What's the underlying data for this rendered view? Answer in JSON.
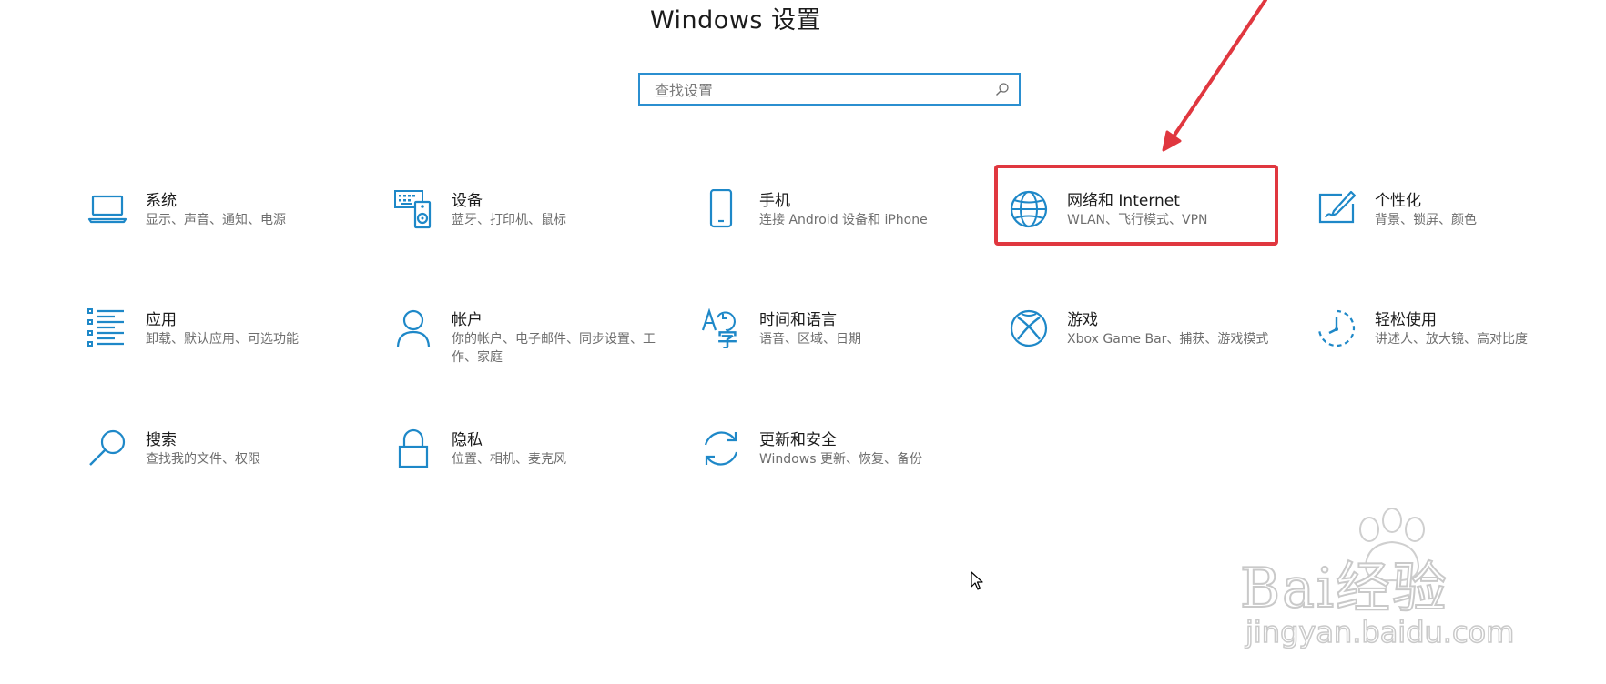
{
  "window": {
    "title": "Windows 设置"
  },
  "search": {
    "placeholder": "查找设置",
    "value": ""
  },
  "tiles": [
    {
      "title": "系统",
      "desc": "显示、声音、通知、电源",
      "icon": "laptop-icon"
    },
    {
      "title": "设备",
      "desc": "蓝牙、打印机、鼠标",
      "icon": "keyboard-speaker-icon"
    },
    {
      "title": "手机",
      "desc": "连接 Android 设备和 iPhone",
      "icon": "phone-icon"
    },
    {
      "title": "网络和 Internet",
      "desc": "WLAN、飞行模式、VPN",
      "icon": "globe-icon"
    },
    {
      "title": "个性化",
      "desc": "背景、锁屏、颜色",
      "icon": "pen-tablet-icon"
    },
    {
      "title": "应用",
      "desc": "卸载、默认应用、可选功能",
      "icon": "apps-list-icon"
    },
    {
      "title": "帐户",
      "desc": "你的帐户、电子邮件、同步设置、工作、家庭",
      "icon": "person-icon"
    },
    {
      "title": "时间和语言",
      "desc": "语音、区域、日期",
      "icon": "time-language-icon"
    },
    {
      "title": "游戏",
      "desc": "Xbox Game Bar、捕获、游戏模式",
      "icon": "xbox-icon"
    },
    {
      "title": "轻松使用",
      "desc": "讲述人、放大镜、高对比度",
      "icon": "ease-of-access-icon"
    },
    {
      "title": "搜索",
      "desc": "查找我的文件、权限",
      "icon": "magnifier-icon"
    },
    {
      "title": "隐私",
      "desc": "位置、相机、麦克风",
      "icon": "lock-icon"
    },
    {
      "title": "更新和安全",
      "desc": "Windows 更新、恢复、备份",
      "icon": "sync-icon"
    }
  ],
  "annotation": {
    "highlight_color": "#e0373f",
    "accent_color": "#2b8fd0"
  },
  "watermark": {
    "brand": "Bai经验",
    "site": "jingyan.baidu.com"
  }
}
